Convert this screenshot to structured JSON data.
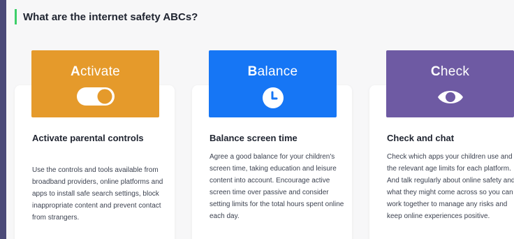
{
  "section": {
    "heading": "What are the internet safety ABCs?",
    "accent_color": "#3ecf6a"
  },
  "cards": [
    {
      "tile_color": "#e59a2b",
      "tile_initial": "A",
      "tile_rest": "ctivate",
      "icon": "toggle-switch-icon",
      "title": "Activate parental controls",
      "body": "Use the controls and tools available from broadband providers, online platforms and apps to install safe search settings, block inappropriate content and prevent contact from strangers."
    },
    {
      "tile_color": "#1676f5",
      "tile_initial": "B",
      "tile_rest": "alance",
      "icon": "clock-icon",
      "title": "Balance screen time",
      "body": "Agree a good balance for your children's screen time, taking education and leisure content into account. Encourage active screen time over passive and consider setting limits for the total hours spent online each day."
    },
    {
      "tile_color": "#6e5aa3",
      "tile_initial": "C",
      "tile_rest": "heck",
      "icon": "eye-icon",
      "title": "Check and chat",
      "body": "Check which apps your children use and the relevant age limits for each platform. And talk regularly about online safety and what they might come across so you can work together to manage any risks and keep online experiences positive."
    }
  ]
}
